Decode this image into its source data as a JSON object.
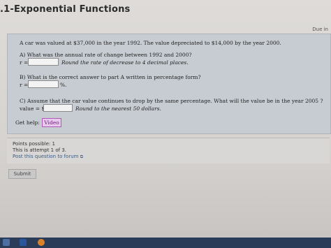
{
  "header": {
    "title": ".1-Exponential Functions",
    "due": "Due in"
  },
  "question": {
    "intro": "A car was valued at $37,000 in the year 1992. The value depreciated to $14,000 by the year 2000.",
    "partA": {
      "prompt": "A) What was the annual rate of change between 1992 and 2000?",
      "label": "r =",
      "hint": "Round the rate of decrease to 4 decimal places."
    },
    "partB": {
      "prompt": "B) What is the correct answer to part A written in percentage form?",
      "label": "r =",
      "suffix": "%."
    },
    "partC": {
      "prompt": "C) Assume that the car value continues to drop by the same percentage. What will the value be in the year 2005 ?",
      "label": "value = $",
      "hint": "Round to the nearest 50 dollars."
    },
    "help": {
      "label": "Get help:",
      "video": "Video"
    }
  },
  "info": {
    "points": "Points possible: 1",
    "attempt": "This is attempt 1 of 3.",
    "forum": "Post this question to forum"
  },
  "submit_label": "Submit"
}
